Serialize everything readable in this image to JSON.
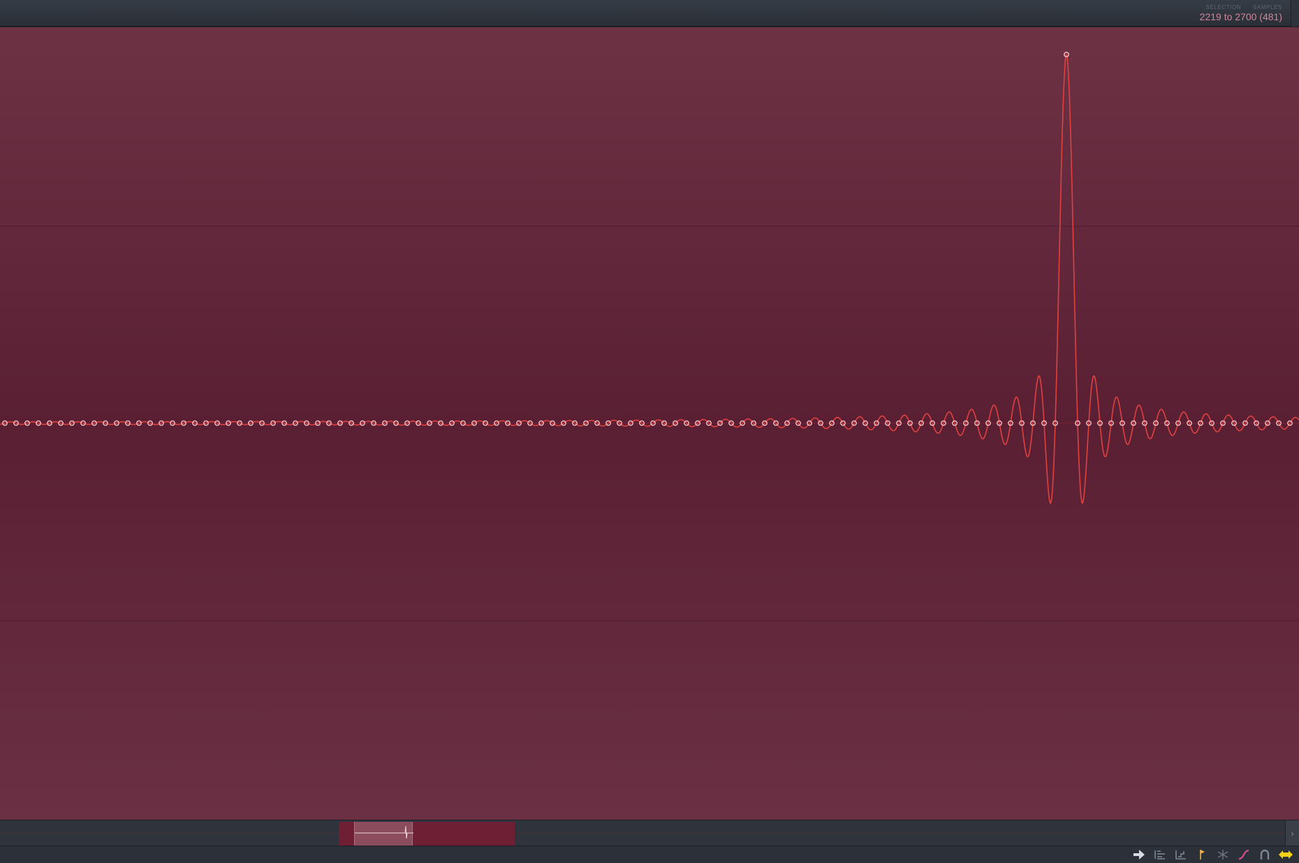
{
  "header": {
    "selection_label": "SELECTION",
    "samples_label": "SAMPLES",
    "range_text": "2219 to 2700 (481)"
  },
  "waveform": {
    "line_color": "#e0413f",
    "point_fill": "#f7c3c9",
    "background_top": "#6d3244",
    "background_mid": "#5a1f33"
  },
  "toolbar": {
    "tools": [
      {
        "name": "arrow-right-icon",
        "color": "#d5dbe6"
      },
      {
        "name": "align-left-icon",
        "color": "#7d8593"
      },
      {
        "name": "step-icon",
        "color": "#7d8593"
      },
      {
        "name": "marker-flag-icon",
        "color": "#f0b04a"
      },
      {
        "name": "snowflake-icon",
        "color": "#6d7482"
      },
      {
        "name": "curve-pencil-icon",
        "color": "#e0509e"
      },
      {
        "name": "magnet-icon",
        "color": "#7d8593"
      },
      {
        "name": "stretch-arrows-icon",
        "color": "#f2d313"
      }
    ]
  }
}
